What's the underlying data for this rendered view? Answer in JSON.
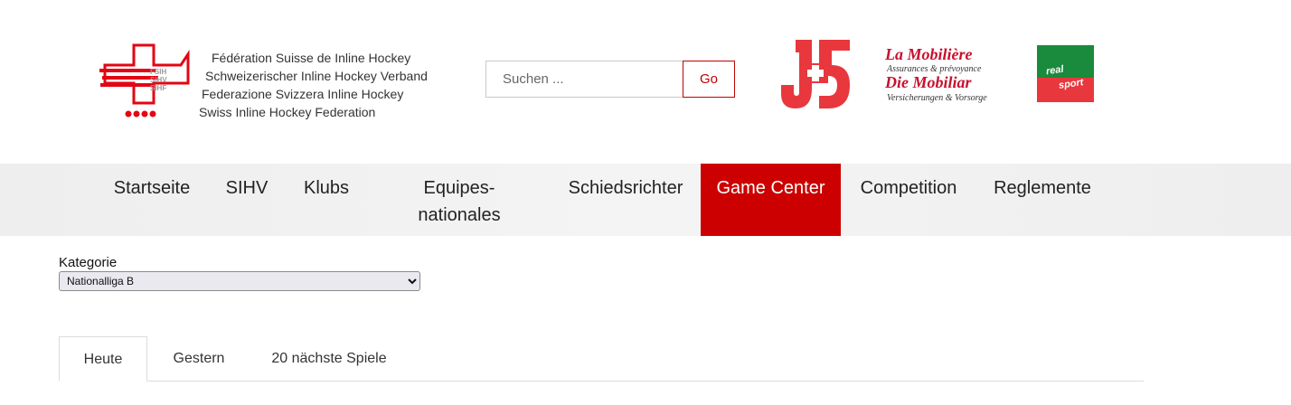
{
  "header": {
    "federation_names": [
      "Fédération Suisse de Inline Hockey",
      "Schweizerischer Inline Hockey Verband",
      "Federazione Svizzera Inline Hockey",
      "Swiss Inline Hockey Federation"
    ],
    "logo_mark_text": [
      "FSIH",
      "SIHV",
      "SIHF"
    ],
    "search": {
      "placeholder": "Suchen ...",
      "value": "",
      "button_label": "Go"
    }
  },
  "sponsors": {
    "js_logo": "j-plus-s-logo",
    "mobiliar": {
      "line1": "La Mobilière",
      "line2": "Assurances & prévoyance",
      "line3": "Die Mobiliar",
      "line4": "Versicherungen & Vorsorge"
    },
    "realsport": {
      "top": "real",
      "bottom": "sport"
    }
  },
  "nav": {
    "items": [
      {
        "label": "Startseite",
        "active": false
      },
      {
        "label": "SIHV",
        "active": false
      },
      {
        "label": "Klubs",
        "active": false
      },
      {
        "label": "Equipes-nationales",
        "active": false
      },
      {
        "label": "Schiedsrichter",
        "active": false
      },
      {
        "label": "Game Center",
        "active": true
      },
      {
        "label": "Competition",
        "active": false
      },
      {
        "label": "Reglemente",
        "active": false
      }
    ]
  },
  "filter": {
    "label": "Kategorie",
    "selected": "Nationalliga B",
    "options": [
      "Nationalliga B"
    ]
  },
  "tabs": [
    {
      "label": "Heute",
      "active": true
    },
    {
      "label": "Gestern",
      "active": false
    },
    {
      "label": "20 nächste Spiele",
      "active": false
    }
  ],
  "colors": {
    "accent": "#cc0000",
    "nav_bg": "#f0f0f0"
  }
}
